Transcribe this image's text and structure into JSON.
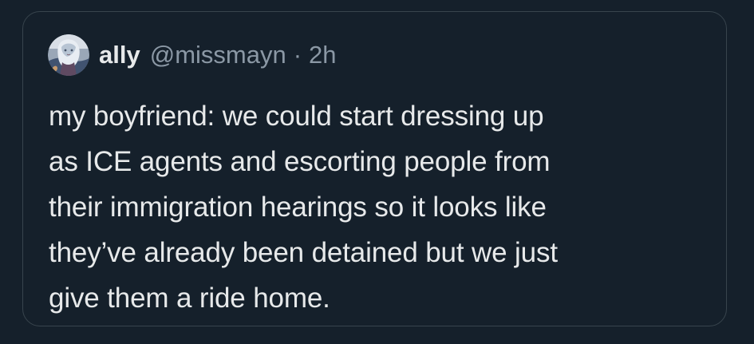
{
  "tweet": {
    "author": {
      "display_name": "ally",
      "handle": "@missmayn",
      "avatar_icon": "profile-avatar-illustration"
    },
    "separator": "·",
    "timestamp": "2h",
    "text": "my boyfriend: we could start dressing up\nas ICE agents and escorting people from\ntheir immigration hearings so it looks like\nthey’ve already been detained but we just\ngive them a ride home."
  },
  "colors": {
    "background": "#15202b",
    "card_border": "#38444d",
    "primary_text": "#e7e9ea",
    "secondary_text": "#8b98a5"
  }
}
